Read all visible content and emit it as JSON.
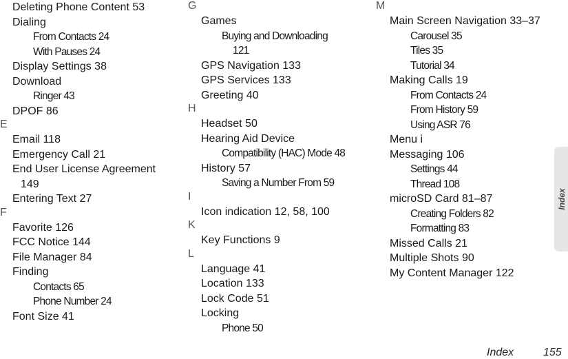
{
  "columns": [
    {
      "blocks": [
        {
          "type": "entry",
          "text": "Deleting Phone Content 53"
        },
        {
          "type": "entry",
          "text": "Dialing"
        },
        {
          "type": "sub",
          "text": "From Contacts 24"
        },
        {
          "type": "sub",
          "text": "With Pauses 24"
        },
        {
          "type": "entry",
          "text": "Display Settings 38"
        },
        {
          "type": "entry",
          "text": "Download"
        },
        {
          "type": "sub",
          "text": "Ringer 43"
        },
        {
          "type": "entry",
          "text": "DPOF 86"
        },
        {
          "type": "letter",
          "text": "E"
        },
        {
          "type": "entry",
          "text": "Email 118"
        },
        {
          "type": "entry",
          "text": "Emergency Call 21"
        },
        {
          "type": "entry",
          "text": "End User License Agreement",
          "cont": "149"
        },
        {
          "type": "entry",
          "text": "Entering Text 27"
        },
        {
          "type": "letter",
          "text": "F"
        },
        {
          "type": "entry",
          "text": "Favorite 126"
        },
        {
          "type": "entry",
          "text": "FCC Notice 144"
        },
        {
          "type": "entry",
          "text": "File Manager 84"
        },
        {
          "type": "entry",
          "text": "Finding"
        },
        {
          "type": "sub",
          "text": "Contacts 65"
        },
        {
          "type": "sub",
          "text": "Phone Number 24"
        },
        {
          "type": "entry",
          "text": "Font Size 41"
        }
      ]
    },
    {
      "blocks": [
        {
          "type": "letter",
          "text": "G"
        },
        {
          "type": "entry",
          "text": "Games"
        },
        {
          "type": "sub",
          "text": "Buying and Downloading",
          "cont": "121"
        },
        {
          "type": "entry",
          "text": "GPS Navigation 133"
        },
        {
          "type": "entry",
          "text": "GPS Services 133"
        },
        {
          "type": "entry",
          "text": "Greeting 40"
        },
        {
          "type": "letter",
          "text": "H"
        },
        {
          "type": "entry",
          "text": "Headset 50"
        },
        {
          "type": "entry",
          "text": "Hearing Aid Device"
        },
        {
          "type": "sub",
          "text": "Compatibility (HAC) Mode 48"
        },
        {
          "type": "entry",
          "text": "History 57"
        },
        {
          "type": "sub",
          "text": "Saving a Number From 59"
        },
        {
          "type": "letter",
          "text": "I"
        },
        {
          "type": "entry",
          "text": "Icon indication 12, 58, 100"
        },
        {
          "type": "letter",
          "text": "K"
        },
        {
          "type": "entry",
          "text": "Key Functions 9"
        },
        {
          "type": "letter",
          "text": "L"
        },
        {
          "type": "entry",
          "text": "Language 41"
        },
        {
          "type": "entry",
          "text": "Location 133"
        },
        {
          "type": "entry",
          "text": "Lock Code 51"
        },
        {
          "type": "entry",
          "text": "Locking"
        },
        {
          "type": "sub",
          "text": "Phone 50"
        }
      ]
    },
    {
      "blocks": [
        {
          "type": "letter",
          "text": "M"
        },
        {
          "type": "entry",
          "text": "Main Screen Navigation 33–37"
        },
        {
          "type": "sub",
          "text": "Carousel 35"
        },
        {
          "type": "sub",
          "text": "Tiles 35"
        },
        {
          "type": "sub",
          "text": "Tutorial 34"
        },
        {
          "type": "entry",
          "text": "Making Calls 19"
        },
        {
          "type": "sub",
          "text": "From Contacts 24"
        },
        {
          "type": "sub",
          "text": "From History 59"
        },
        {
          "type": "sub",
          "text": "Using ASR 76"
        },
        {
          "type": "entry",
          "text": "Menu i"
        },
        {
          "type": "entry",
          "text": "Messaging 106"
        },
        {
          "type": "sub",
          "text": "Settings 44"
        },
        {
          "type": "sub",
          "text": "Thread 108"
        },
        {
          "type": "entry",
          "text": "microSD Card 81–87"
        },
        {
          "type": "sub",
          "text": "Creating Folders 82"
        },
        {
          "type": "sub",
          "text": "Formatting 83"
        },
        {
          "type": "entry",
          "text": "Missed Calls 21"
        },
        {
          "type": "entry",
          "text": "Multiple Shots 90"
        },
        {
          "type": "entry",
          "text": "My Content Manager 122"
        }
      ]
    }
  ],
  "side_tab": {
    "label": "Index"
  },
  "footer": {
    "section": "Index",
    "page": "155"
  },
  "colors": {
    "letter_header": "#555555",
    "text": "#1a1a1a",
    "side_tab_bg": "#e6e6e6"
  }
}
